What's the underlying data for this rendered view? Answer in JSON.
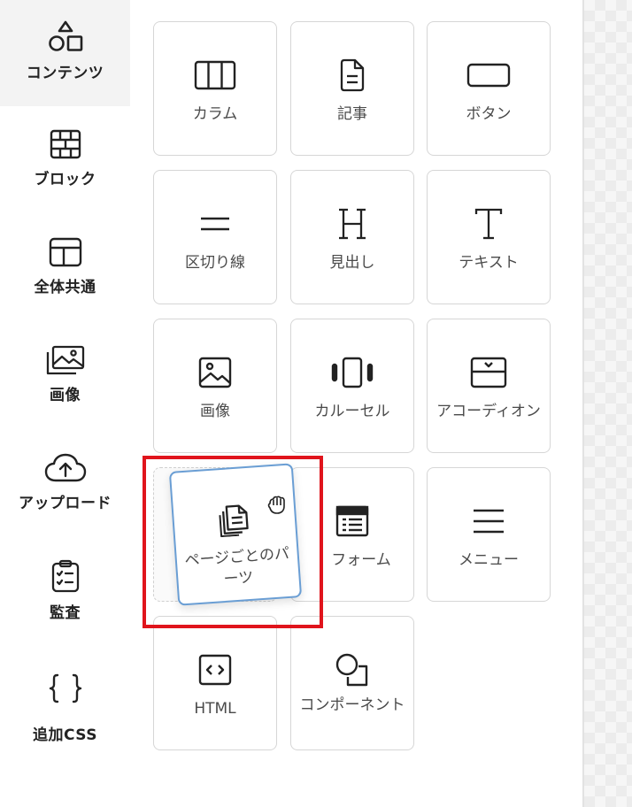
{
  "sidebar": {
    "items": [
      {
        "label": "コンテンツ",
        "icon": "shapes-icon",
        "active": true
      },
      {
        "label": "ブロック",
        "icon": "brick-wall-icon"
      },
      {
        "label": "全体共通",
        "icon": "layout-icon"
      },
      {
        "label": "画像",
        "icon": "images-icon"
      },
      {
        "label": "アップロード",
        "icon": "cloud-upload-icon"
      },
      {
        "label": "監査",
        "icon": "clipboard-check-icon"
      },
      {
        "label": "追加CSS",
        "icon": "braces-icon"
      }
    ]
  },
  "grid": {
    "cards": [
      {
        "label": "カラム",
        "icon": "columns-icon"
      },
      {
        "label": "記事",
        "icon": "document-icon"
      },
      {
        "label": "ボタン",
        "icon": "button-icon"
      },
      {
        "label": "区切り線",
        "icon": "divider-icon"
      },
      {
        "label": "見出し",
        "icon": "heading-icon"
      },
      {
        "label": "テキスト",
        "icon": "text-icon"
      },
      {
        "label": "画像",
        "icon": "image-icon"
      },
      {
        "label": "カルーセル",
        "icon": "carousel-icon"
      },
      {
        "label": "アコーディオン",
        "icon": "accordion-icon"
      },
      {
        "label": "フォーム",
        "icon": "form-icon"
      },
      {
        "label": "メニュー",
        "icon": "menu-icon"
      },
      {
        "label": "HTML",
        "icon": "code-icon"
      },
      {
        "label": "コンポーネント",
        "icon": "component-icon"
      }
    ],
    "dragged": {
      "label": "ページごとのパーツ",
      "icon": "copy-pages-icon",
      "cursor": "grab-hand-icon"
    }
  },
  "colors": {
    "highlight": "#e0141c",
    "drag_border": "#6a9ed4"
  }
}
